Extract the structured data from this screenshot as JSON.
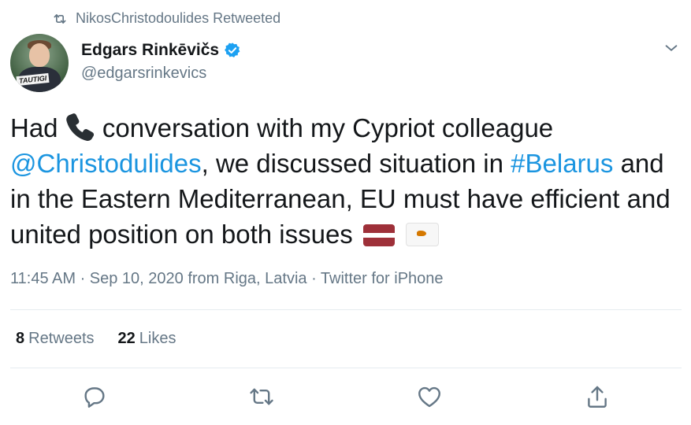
{
  "retweeted_by": "NikosChristodoulides Retweeted",
  "author": {
    "name": "Edgars Rinkēvičs",
    "handle": "@edgarsrinkevics",
    "avatar_tag": "TAUTIGI"
  },
  "tweet": {
    "text_1": "Had ",
    "text_2": " conversation with my Cypriot colleague ",
    "mention": "@Christodulides",
    "text_3": ", we discussed situation in ",
    "hashtag": "#Belarus",
    "text_4": " and in the Eastern Mediterranean, EU must have efficient and united position on both issues "
  },
  "meta": "11:45 AM · Sep 10, 2020 from Riga, Latvia · Twitter for iPhone",
  "stats": {
    "retweets_count": "8",
    "retweets_label": "Retweets",
    "likes_count": "22",
    "likes_label": "Likes"
  },
  "icons": [
    "retweet-icon",
    "verified-badge-icon",
    "chevron-down-icon",
    "telephone-receiver-emoji",
    "flag-latvia-emoji",
    "flag-cyprus-emoji",
    "reply-icon",
    "retweet-icon",
    "like-icon",
    "share-icon"
  ],
  "colors": {
    "link": "#1b95e0",
    "secondary_text": "#657786",
    "primary_text": "#14171a",
    "verified": "#1da1f2"
  }
}
